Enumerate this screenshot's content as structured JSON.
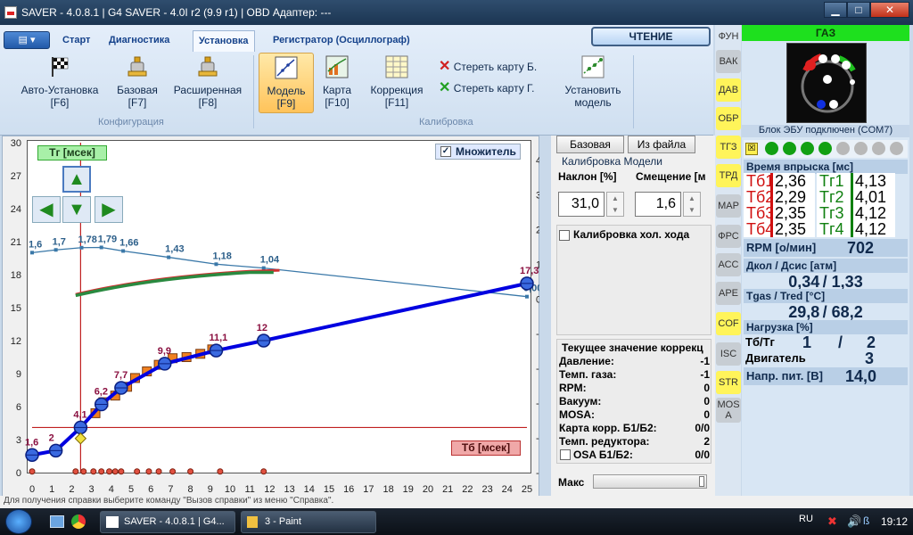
{
  "window": {
    "title": "SAVER - 4.0.8.1  |  G4 SAVER - 4.0I r2 (9.9 r1)  |  OBD Адаптер: ---",
    "min": "▁",
    "max": "□",
    "close": "✕"
  },
  "ribbon": {
    "tabs": [
      "Старт",
      "Диагностика",
      "Установка",
      "Регистратор (Осциллограф)"
    ],
    "active_tab": "Установка",
    "read_button": "ЧТЕНИЕ",
    "config_group": "Конфигурация",
    "calib_group": "Калибровка",
    "auto_setup": {
      "label": "Авто-Установка",
      "key": "[F6]"
    },
    "base": {
      "label": "Базовая",
      "key": "[F7]"
    },
    "extended": {
      "label": "Расширенная",
      "key": "[F8]"
    },
    "model": {
      "label": "Модель",
      "key": "[F9]"
    },
    "map": {
      "label": "Карта",
      "key": "[F10]"
    },
    "correction": {
      "label": "Коррекция",
      "key": "[F11]"
    },
    "erase_b": "Стереть карту Б.",
    "erase_g": "Стереть карту Г.",
    "install_model": [
      "Установить",
      "модель"
    ]
  },
  "chart_panel": {
    "tg_label": "Тг [мсек]",
    "tb_label": "Тб [мсек]",
    "multiplier": "Множитель"
  },
  "chart_data": {
    "type": "line",
    "xlabel": "Тб [мсек]",
    "ylabel": "Тг [мсек]",
    "x_ticks": [
      0,
      1,
      2,
      3,
      4,
      5,
      6,
      7,
      8,
      9,
      10,
      11,
      12,
      13,
      14,
      15,
      16,
      17,
      18,
      19,
      20,
      21,
      22,
      23,
      24,
      25
    ],
    "y_ticks": [
      0,
      3,
      6,
      9,
      12,
      15,
      18,
      21,
      24,
      27,
      30
    ],
    "y2_ticks": [
      -5,
      -4,
      -3,
      -2,
      -1,
      0,
      1,
      2,
      3,
      4
    ],
    "xlim": [
      0,
      25
    ],
    "ylim": [
      0,
      30
    ],
    "y2lim": [
      -5,
      4.5
    ],
    "series": [
      {
        "color": "#0000e0",
        "x": [
          0,
          1.2,
          2.45,
          3.5,
          4.5,
          6.7,
          9.3,
          11.7,
          25
        ],
        "y": [
          1.6,
          2.0,
          4.1,
          6.2,
          7.7,
          9.9,
          11.1,
          12.0,
          17.2
        ]
      },
      {
        "color": "#3a78a8",
        "x": [
          0,
          1.2,
          2.5,
          3.5,
          4.6,
          6.9,
          9.3,
          11.7,
          25
        ],
        "y": [
          1.6,
          1.7,
          1.78,
          1.79,
          1.66,
          1.43,
          1.18,
          1.04,
          0.0
        ]
      }
    ],
    "point_labels_main": [
      "1,6",
      "2",
      "4,1",
      "6,2",
      "7,7",
      "9,9",
      "11,1",
      "12",
      "17,3"
    ],
    "point_labels_ratio": [
      "1,6",
      "1,7",
      "1,78",
      "1,79",
      "1,66",
      "1,43",
      "1,18",
      "1,04",
      "0,00"
    ],
    "cursor": {
      "x": 2.45,
      "y": 4.1
    }
  },
  "calib": {
    "btn_base": "Базовая",
    "btn_file": "Из файла",
    "title": "Калибровка Модели",
    "slope_label": "Наклон [%]",
    "offset_label": "Смещение [м",
    "slope": "31,0",
    "offset": "1,6",
    "cold_label": "Калибровка хол. хода",
    "current_title": "Текущее значение коррекц",
    "rows": [
      {
        "k": "Давление:",
        "v": "-1"
      },
      {
        "k": "Темп. газа:",
        "v": "-1"
      },
      {
        "k": "RPM:",
        "v": "0"
      },
      {
        "k": "Вакуум:",
        "v": "0"
      },
      {
        "k": "MOSA:",
        "v": "0"
      },
      {
        "k": "Карта корр. Б1/Б2:",
        "v": "0/0"
      },
      {
        "k": "Темп. редуктора:",
        "v": "2"
      },
      {
        "k": "OSA Б1/Б2:",
        "v": "0/0"
      }
    ],
    "max_label": "Макс"
  },
  "side_tabs": [
    "ФУН",
    "ВАК",
    "ДАВ",
    "ОБР",
    "ТГЗ",
    "ТРД",
    "МАР",
    "ФРС",
    "АСС",
    "АРЕ",
    "COF",
    "ISC",
    "STR",
    "MOS A"
  ],
  "status": {
    "fuel": "ГАЗ",
    "ecu": "Блок ЭБУ подключен (COM7)",
    "inj_title": "Время впрыска [мс]",
    "inj": [
      {
        "b": "Тб1",
        "bv": "2,36",
        "g": "Тг1",
        "gv": "4,13"
      },
      {
        "b": "Тб2",
        "bv": "2,29",
        "g": "Тг2",
        "gv": "4,01"
      },
      {
        "b": "Тб3",
        "bv": "2,35",
        "g": "Тг3",
        "gv": "4,12"
      },
      {
        "b": "Тб4",
        "bv": "2,35",
        "g": "Тг4",
        "gv": "4,12"
      }
    ],
    "rpm_label": "RPM [о/мин]",
    "rpm": "702",
    "press_title": "Дкол / Дсис [атм]",
    "press_a": "0,34",
    "press_b": "1,33",
    "temp_title": "Tgas / Tred [°C]",
    "temp_a": "29,8",
    "temp_b": "68,2",
    "load_title": "Нагрузка [%]",
    "load_tb_label": "Тб/Тг",
    "load_tb": "1",
    "load_tg": "2",
    "engine_label": "Двигатель",
    "engine": "3",
    "volt_label": "Напр. пит. [В]",
    "volt": "14,0"
  },
  "statusbar": "Для получения справки выберите команду \"Вызов справки\" из меню \"Справка\".",
  "taskbar": {
    "task1": "SAVER - 4.0.8.1  |  G4...",
    "task2": "3 - Paint",
    "lang": "RU",
    "clock": "19:12"
  }
}
